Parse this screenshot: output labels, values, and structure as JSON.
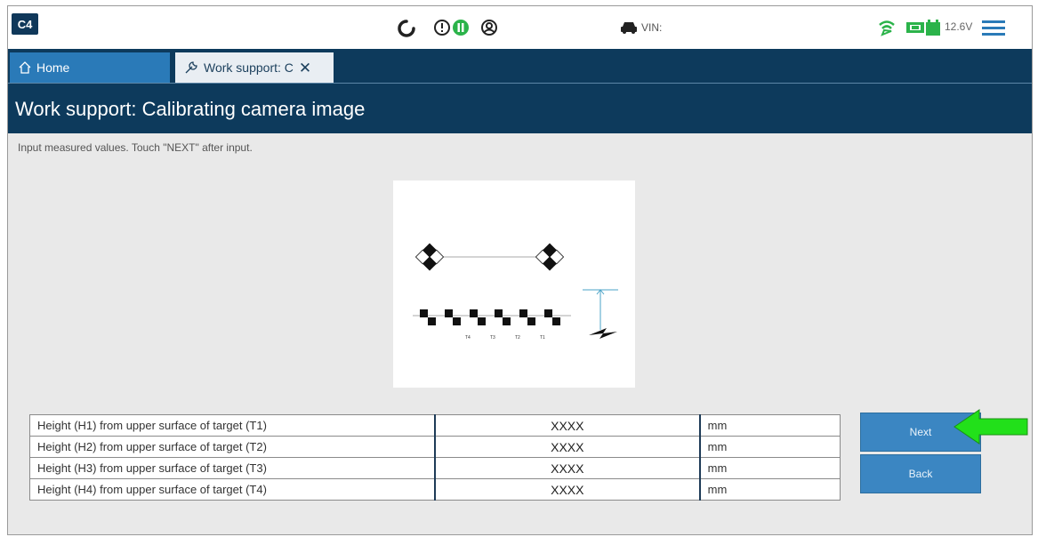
{
  "app": {
    "logo_text": "C4",
    "vin_label": "VIN:",
    "voltage": "12.6V"
  },
  "tabs": [
    {
      "label": "Home",
      "icon": "home-icon"
    },
    {
      "label": "Work support: C",
      "icon": "wrench-icon",
      "close": "✕"
    }
  ],
  "page": {
    "title": "Work support: Calibrating camera image",
    "instruction": "Input measured values. Touch \"NEXT\" after input."
  },
  "diagram": {
    "target_labels": [
      "T4",
      "T3",
      "T2",
      "T1"
    ]
  },
  "measurements": [
    {
      "label": "Height (H1) from upper surface of target (T1)",
      "value": "XXXX",
      "unit": "mm"
    },
    {
      "label": "Height (H2) from upper surface of target (T2)",
      "value": "XXXX",
      "unit": "mm"
    },
    {
      "label": "Height (H3) from upper surface of target (T3)",
      "value": "XXXX",
      "unit": "mm"
    },
    {
      "label": "Height (H4) from upper surface of target (T4)",
      "value": "XXXX",
      "unit": "mm"
    }
  ],
  "buttons": {
    "next": "Next",
    "back": "Back"
  },
  "colors": {
    "header_navy": "#0d3a5c",
    "tab_blue": "#2a7ab8",
    "button_blue": "#3b86c2",
    "status_green": "#2bb34a",
    "callout_arrow": "#22e01a"
  }
}
